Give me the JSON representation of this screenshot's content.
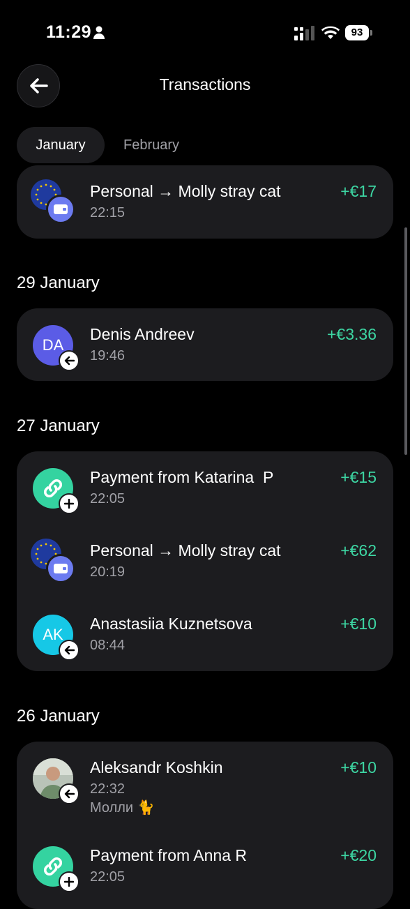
{
  "status_bar": {
    "time": "11:29",
    "battery": "93"
  },
  "header": {
    "title": "Transactions",
    "back_icon": "arrow-left-icon"
  },
  "tabs": [
    {
      "label": "January",
      "active": true
    },
    {
      "label": "February",
      "active": false
    }
  ],
  "colors": {
    "background": "#000000",
    "card": "#1c1c1f",
    "amount_positive": "#3dd6a3",
    "muted_text": "#a0a0a6"
  },
  "sections": [
    {
      "date": "",
      "transactions": [
        {
          "title": "Personal → Molly stray cat",
          "time": "22:15",
          "amount": "+€17",
          "avatar": "eu-flag-wallet-icon"
        }
      ]
    },
    {
      "date": "29 January",
      "transactions": [
        {
          "title": "Denis Andreev",
          "time": "19:46",
          "amount": "+€3.36",
          "initials": "DA",
          "avatar_color": "#5b5ce6",
          "badge": "arrow-left-icon"
        }
      ]
    },
    {
      "date": "27 January",
      "transactions": [
        {
          "title": "Payment from Katarina  P",
          "time": "22:05",
          "amount": "+€15",
          "avatar": "link-icon",
          "badge": "plus-icon"
        },
        {
          "title": "Personal → Molly stray cat",
          "time": "20:19",
          "amount": "+€62",
          "avatar": "eu-flag-wallet-icon"
        },
        {
          "title": "Anastasiia Kuznetsova",
          "time": "08:44",
          "amount": "+€10",
          "initials": "AK",
          "avatar_color": "#16c8e6",
          "badge": "arrow-left-icon"
        }
      ]
    },
    {
      "date": "26 January",
      "transactions": [
        {
          "title": "Aleksandr Koshkin",
          "time": "22:32",
          "note": "Молли 🐈",
          "amount": "+€10",
          "avatar": "photo-avatar",
          "badge": "arrow-left-icon"
        },
        {
          "title": "Payment from Anna R",
          "time": "22:05",
          "amount": "+€20",
          "avatar": "link-icon",
          "badge": "plus-icon"
        }
      ]
    }
  ]
}
